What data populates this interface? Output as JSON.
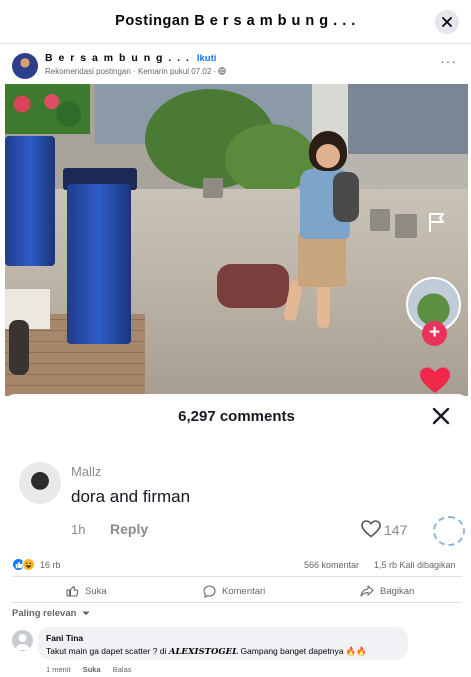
{
  "dialog": {
    "title": "Postingan B e r s a m b u n g . . ."
  },
  "post": {
    "author": "B e r s a m b u n g . . .",
    "follow_label": "Ikuti",
    "sub_label": "Rekomendasi postingan · Kemarin pukul 07.02 · ",
    "more_label": "···"
  },
  "video_overlay": {
    "plus_label": "+"
  },
  "comments_sheet": {
    "title": "6,297 comments",
    "top_comment": {
      "user": "Mallz",
      "text": "dora and firman",
      "time": "1h",
      "reply_label": "Reply",
      "likes": "147"
    }
  },
  "stats": {
    "reactions": "16 rb",
    "comments": "566 komentar",
    "shares": "1,5 rb Kali dibagikan"
  },
  "actions": {
    "like": "Suka",
    "comment": "Komentari",
    "share": "Bagikan"
  },
  "comment_sort": "Paling relevan",
  "comments": [
    {
      "name": "Fani Tina",
      "text_before": "Takut main ga dapet scatter ? di ",
      "brand": "ALEXISTOGEL",
      "text_after": " Gampang banget dapetnya 🔥🔥",
      "time": "1 menit",
      "like_label": "Suka",
      "reply_label": "Balas"
    }
  ],
  "colors": {
    "accent": "#1877f2",
    "like_blue": "#1877f2",
    "heart_red": "#f02849",
    "tiktok_pink": "#e8345a"
  }
}
